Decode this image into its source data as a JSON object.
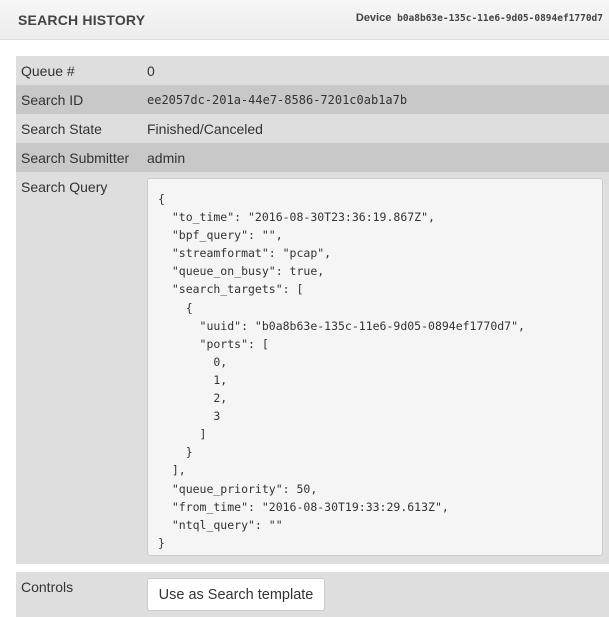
{
  "header": {
    "title": "SEARCH HISTORY",
    "device_label": "Device",
    "device_id": "b0a8b63e-135c-11e6-9d05-0894ef1770d7"
  },
  "rows": [
    {
      "label": "Queue #",
      "value": "0"
    },
    {
      "label": "Search ID",
      "value": "ee2057dc-201a-44e7-8586-7201c0ab1a7b"
    },
    {
      "label": "Search State",
      "value": "Finished/Canceled"
    },
    {
      "label": "Search Submitter",
      "value": "admin"
    }
  ],
  "query": {
    "label": "Search Query",
    "json": "{\n  \"to_time\": \"2016-08-30T23:36:19.867Z\",\n  \"bpf_query\": \"\",\n  \"streamformat\": \"pcap\",\n  \"queue_on_busy\": true,\n  \"search_targets\": [\n    {\n      \"uuid\": \"b0a8b63e-135c-11e6-9d05-0894ef1770d7\",\n      \"ports\": [\n        0,\n        1,\n        2,\n        3\n      ]\n    }\n  ],\n  \"queue_priority\": 50,\n  \"from_time\": \"2016-08-30T19:33:29.613Z\",\n  \"ntql_query\": \"\"\n}"
  },
  "controls": {
    "label": "Controls",
    "template_button": "Use as Search template"
  }
}
